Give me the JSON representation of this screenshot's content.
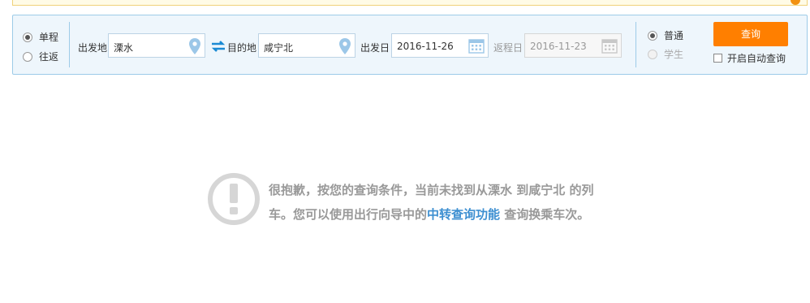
{
  "trip_type": {
    "one_way": "单程",
    "round_trip": "往返"
  },
  "from": {
    "label": "出发地",
    "value": "溧水"
  },
  "to": {
    "label": "目的地",
    "value": "咸宁北"
  },
  "depart_date": {
    "label": "出发日",
    "value": "2016-11-26"
  },
  "return_date": {
    "label": "返程日",
    "value": "2016-11-23"
  },
  "passenger": {
    "normal": "普通",
    "student": "学生"
  },
  "query_button": "查询",
  "auto_query_label": "开启自动查询",
  "notice": {
    "text_before": "很抱歉，按您的查询条件，当前未找到从溧水 到咸宁北 的列车。您可以使用出行向导中的",
    "link": "中转查询功能",
    "text_after": " 查询换乘车次。"
  },
  "colors": {
    "accent": "#ff7f00",
    "link": "#3d8fd1",
    "panel_bg": "#eef6fc",
    "panel_border": "#9dcbe8"
  },
  "icons": {
    "location": "map-pin",
    "swap": "swap-arrows",
    "calendar": "calendar",
    "notice": "exclamation-circle"
  }
}
